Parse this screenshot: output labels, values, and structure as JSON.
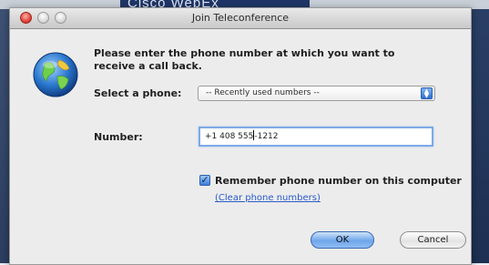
{
  "background": {
    "banner_text": "Cisco WebEx"
  },
  "window": {
    "title": "Join Teleconference"
  },
  "dialog": {
    "prompt": "Please enter the phone number at which you want to receive a call back.",
    "select_phone_label": "Select a phone:",
    "select_phone_value": "-- Recently used numbers --",
    "number_label": "Number:",
    "number_value_before_caret": "+1 408 555",
    "number_value_after_caret": "-1212",
    "remember_label": "Remember phone number on this computer",
    "remember_checked": true,
    "clear_link": "(Clear phone numbers)",
    "ok_label": "OK",
    "cancel_label": "Cancel"
  },
  "icons": {
    "app_icon": "globe-icon",
    "close": "close-icon",
    "minimize": "minimize-icon",
    "zoom": "zoom-icon",
    "select_arrows": "updown-arrows-icon",
    "checkmark": "checkmark-icon"
  },
  "colors": {
    "accent": "#3b7dd8",
    "link": "#2a5bc8",
    "close_button": "#e0443a"
  }
}
